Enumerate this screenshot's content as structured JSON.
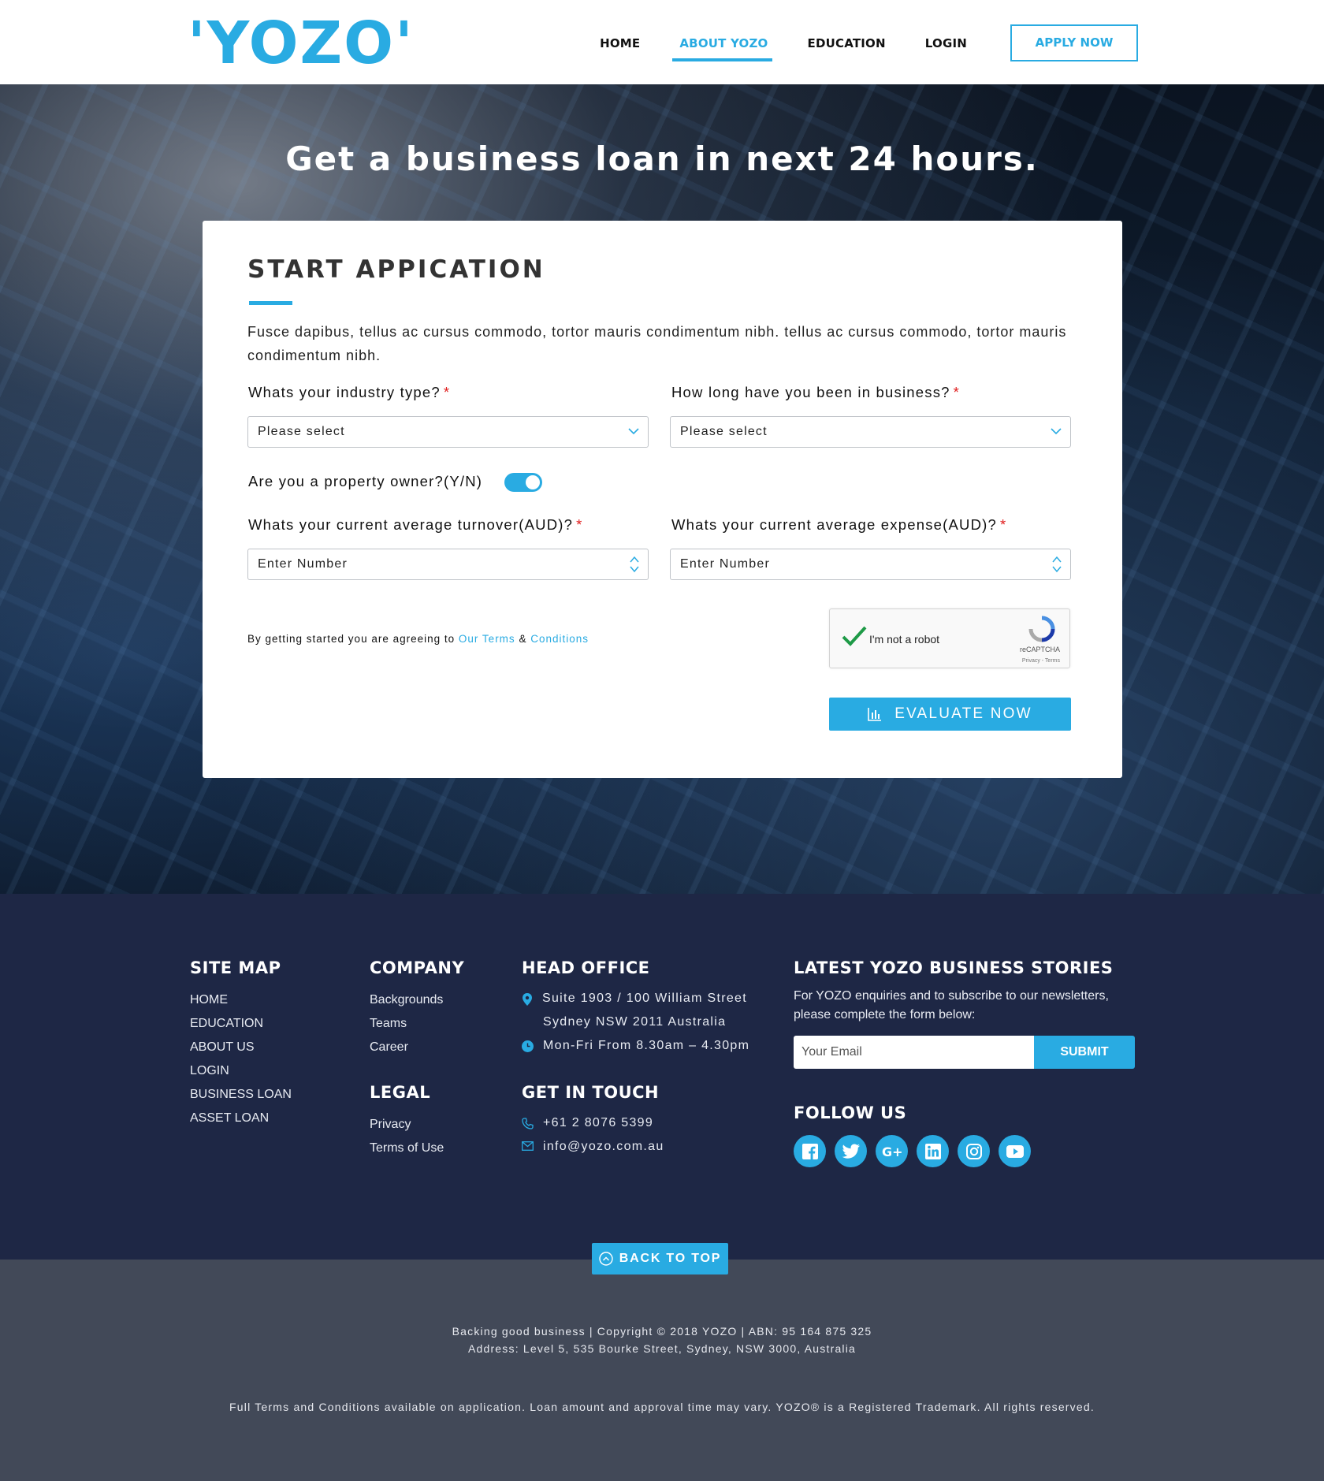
{
  "header": {
    "logo_text": "'YOZO'",
    "nav": [
      {
        "label": "HOME"
      },
      {
        "label": "ABOUT YOZO"
      },
      {
        "label": "EDUCATION"
      },
      {
        "label": "LOGIN"
      }
    ],
    "active_nav": "ABOUT YOZO",
    "apply_label": "APPLY NOW"
  },
  "hero": {
    "title": "Get a business loan in next 24 hours."
  },
  "form": {
    "title": "START APPICATION",
    "description": "Fusce dapibus, tellus ac cursus commodo, tortor mauris condimentum nibh. tellus ac cursus commodo, tortor mauris condimentum nibh.",
    "industry_label": "Whats your industry type?",
    "industry_value": "Please select",
    "duration_label": "How long have you been in business?",
    "duration_value": "Please select",
    "required_mark": "*",
    "property_label": "Are you a property owner?(Y/N)",
    "property_owner_on": true,
    "turnover_label": "Whats your current average turnover(AUD)?",
    "turnover_placeholder": "Enter Number",
    "expense_label": "Whats your current average expense(AUD)?",
    "expense_placeholder": "Enter Number",
    "terms_prefix": "By getting started you are agreeing to",
    "terms_link1": "Our Terms",
    "terms_amp": "&",
    "terms_link2": "Conditions",
    "captcha_label": "I'm not a robot",
    "captcha_brand": "reCAPTCHA",
    "captcha_links": "Privacy - Terms",
    "evaluate_label": "EVALUATE NOW"
  },
  "footer": {
    "sitemap": {
      "title": "SITE MAP",
      "items": [
        "HOME",
        "EDUCATION",
        "ABOUT US",
        "LOGIN",
        "BUSINESS LOAN",
        "ASSET LOAN"
      ]
    },
    "company": {
      "title": "COMPANY",
      "items": [
        "Backgrounds",
        "Teams",
        "Career"
      ]
    },
    "legal": {
      "title": "LEGAL",
      "items": [
        "Privacy",
        "Terms of Use"
      ]
    },
    "head_office": {
      "title": "HEAD OFFICE",
      "address_line1": "Suite 1903 / 100 William Street",
      "address_line2": "Sydney NSW 2011 Australia",
      "hours": "Mon-Fri From 8.30am – 4.30pm"
    },
    "contact": {
      "title": "GET IN TOUCH",
      "phone": "+61 2 8076 5399",
      "email": "info@yozo.com.au"
    },
    "stories": {
      "title": "LATEST YOZO BUSINESS STORIES",
      "text": "For YOZO enquiries and to subscribe to our newsletters, please complete the form below:",
      "email_placeholder": "Your Email",
      "submit_label": "SUBMIT"
    },
    "follow": {
      "title": "FOLLOW US",
      "icons": [
        "facebook-icon",
        "twitter-icon",
        "google-plus-icon",
        "linkedin-icon",
        "instagram-icon",
        "youtube-icon"
      ]
    },
    "back_to_top": "BACK TO TOP"
  },
  "bottom": {
    "line1": "Backing good business | Copyright © 2018 YOZO | ABN: 95 164 875 325",
    "line2": "Address: Level 5, 535 Bourke Street, Sydney, NSW 3000, Australia",
    "line3": "Full Terms and Conditions available on application. Loan amount and approval time may vary. YOZO® is a Registered Trademark. All rights reserved."
  },
  "colors": {
    "accent": "#29abe2",
    "footer_bg": "#1e2745",
    "bottom_bg": "#424958",
    "required": "#e02020"
  }
}
